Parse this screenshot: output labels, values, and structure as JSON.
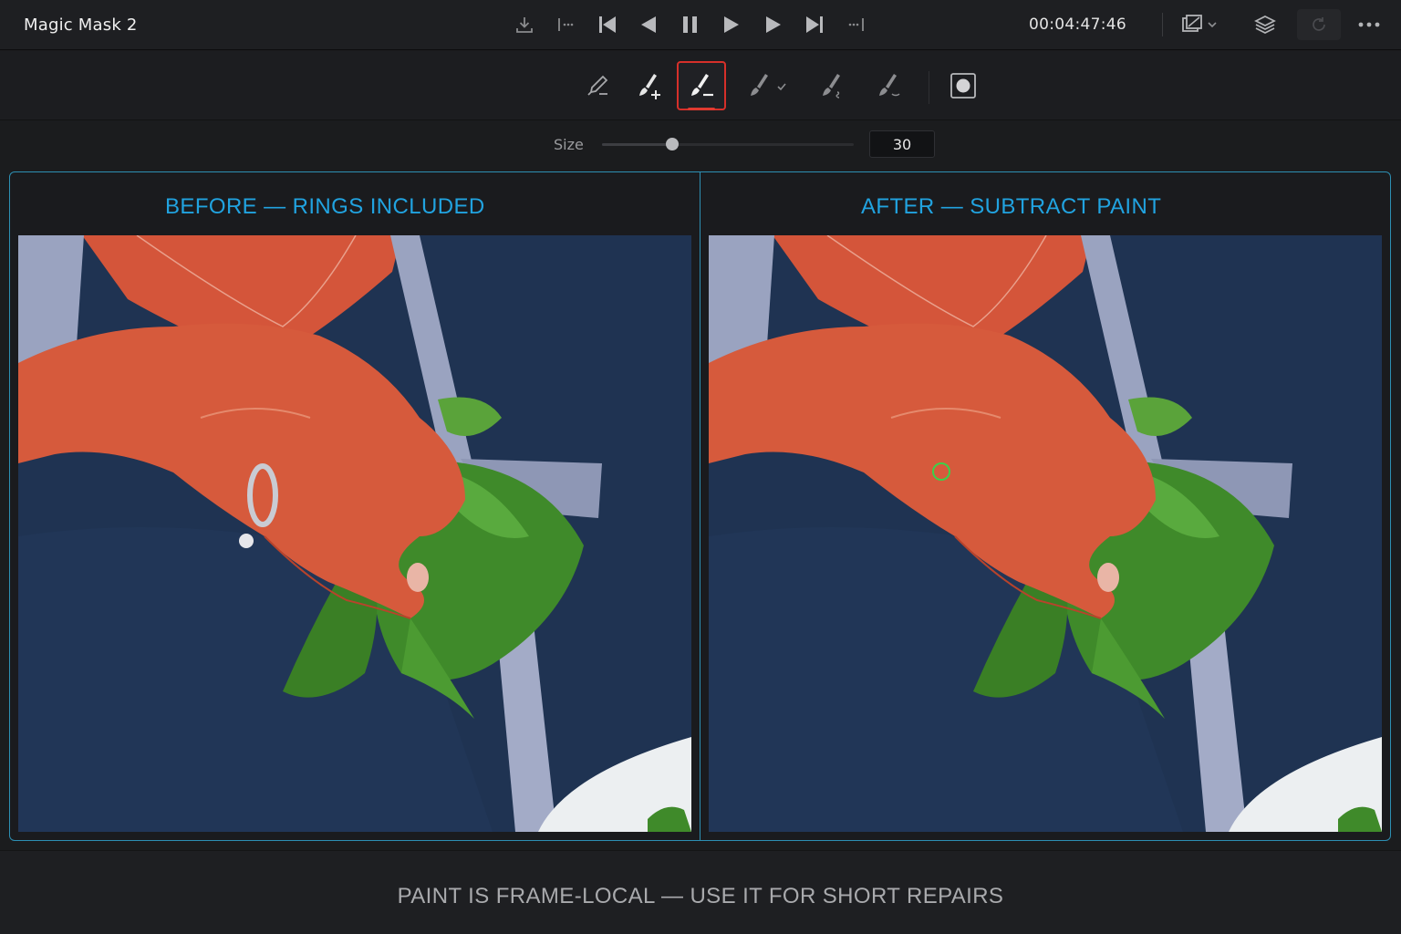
{
  "app": {
    "title": "Magic Mask 2"
  },
  "transport": {
    "buttons": [
      {
        "name": "export-frame",
        "icon": "download-icon"
      },
      {
        "name": "go-to-in",
        "icon": "go-to-in-icon"
      },
      {
        "name": "go-to-start",
        "icon": "skip-back-icon"
      },
      {
        "name": "play-reverse",
        "icon": "play-reverse-icon"
      },
      {
        "name": "pause",
        "icon": "pause-icon"
      },
      {
        "name": "play-forward",
        "icon": "play-icon"
      },
      {
        "name": "play-forward-fast",
        "icon": "play-icon"
      },
      {
        "name": "go-to-end",
        "icon": "skip-forward-icon"
      },
      {
        "name": "go-to-out",
        "icon": "go-to-out-icon"
      }
    ],
    "timecode": "00:04:47:46"
  },
  "tools": {
    "items": [
      {
        "name": "eyedropper-subtract",
        "icon": "eyedropper-icon"
      },
      {
        "name": "paint-add",
        "icon": "brush-add-icon"
      },
      {
        "name": "paint-subtract",
        "icon": "brush-subtract-icon",
        "active": true
      },
      {
        "name": "paint-accept",
        "icon": "brush-check-icon"
      },
      {
        "name": "paint-soft",
        "icon": "brush-soft-icon"
      },
      {
        "name": "paint-erase",
        "icon": "brush-erase-icon"
      }
    ],
    "mask_view": {
      "icon": "mask-overlay-icon"
    }
  },
  "size": {
    "label": "Size",
    "value": "30",
    "fraction": 0.28
  },
  "panels": {
    "before": {
      "title": "BEFORE — RINGS INCLUDED"
    },
    "after": {
      "title": "AFTER — SUBTRACT PAINT"
    }
  },
  "footer": {
    "caption": "PAINT IS FRAME-LOCAL — USE IT FOR SHORT REPAIRS"
  },
  "colors": {
    "accent": "#21a3e0",
    "active_tool": "#d6302a",
    "brush_cursor": "#3bd04a",
    "shirt": "#1f3352",
    "skin": "#d65a3c",
    "basil": "#3f8a2a",
    "strap": "#9aa3c0"
  }
}
